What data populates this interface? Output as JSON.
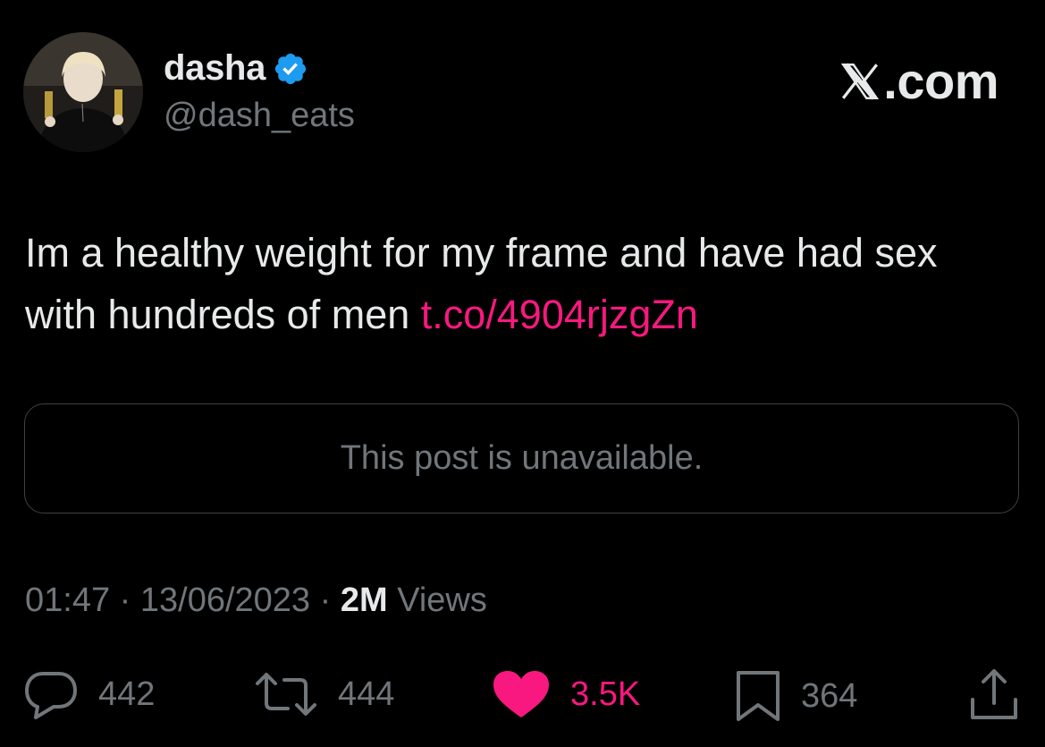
{
  "user": {
    "display_name": "dasha",
    "handle": "@dash_eats",
    "verified": true,
    "verified_color": "#1d9bf0"
  },
  "brand": {
    "label": ".com",
    "icon": "x-logo-icon"
  },
  "tweet": {
    "text": "Im a healthy weight for my frame and have had sex with hundreds of men ",
    "link": "t.co/4904rjzgZn",
    "link_color": "#f91880"
  },
  "quoted_post": {
    "message": "This post is unavailable."
  },
  "meta": {
    "time": "01:47",
    "separator1": " · ",
    "date": "13/06/2023",
    "separator2": " · ",
    "views_count": "2M",
    "views_label": " Views"
  },
  "actions": {
    "replies": {
      "icon": "reply-icon",
      "count": "442"
    },
    "reposts": {
      "icon": "repost-icon",
      "count": "444"
    },
    "likes": {
      "icon": "heart-icon",
      "count": "3.5K",
      "liked": true,
      "color": "#f91880"
    },
    "bookmarks": {
      "icon": "bookmark-icon",
      "count": "364"
    },
    "share": {
      "icon": "share-icon"
    }
  }
}
